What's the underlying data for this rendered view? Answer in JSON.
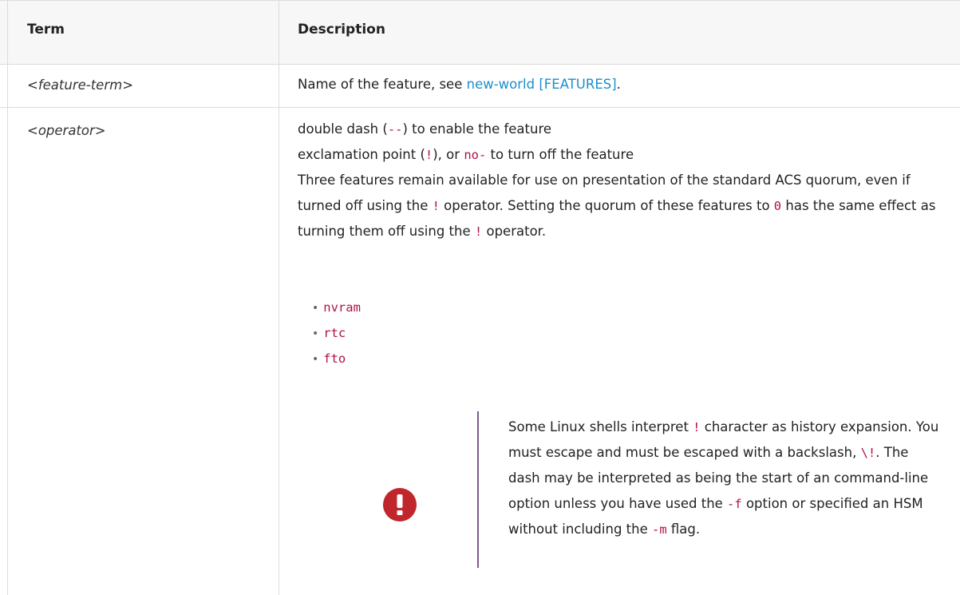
{
  "header": {
    "term": "Term",
    "description": "Description"
  },
  "rows": [
    {
      "term": "<feature-term>",
      "desc_text": "Name of the feature, see ",
      "desc_link": "new-world [FEATURES]",
      "desc_after": "."
    },
    {
      "term": "<operator>",
      "line1": {
        "a": "double dash (",
        "code": "--",
        "b": ") to enable the feature"
      },
      "line2": {
        "a": "exclamation point (",
        "code1": "!",
        "b": "), or ",
        "code2": "no-",
        "c": " to turn off the feature"
      },
      "para": {
        "a": "Three features remain available for use on presentation of the standard ACS quorum, even if turned off using the ",
        "code1": "!",
        "b": " operator. Setting the quorum of these features to ",
        "code2": "0",
        "c": " has the same effect as turning them off using the ",
        "code3": "!",
        "d": " operator."
      },
      "list": [
        "nvram",
        "rtc",
        "fto"
      ],
      "admonition": {
        "icon": "exclamation-circle-icon",
        "icon_color": "#c0272d",
        "a": "Some Linux shells interpret ",
        "code1": "!",
        "b": " character as history expansion. You must escape and must be escaped with a backslash, ",
        "code2": "\\!",
        "c": ". The dash may be interpreted as being the start of an command-line option unless you have used the ",
        "code3": "-f",
        "d": " option or specified an HSM without including the ",
        "code4": "-m",
        "e": " flag."
      }
    }
  ]
}
